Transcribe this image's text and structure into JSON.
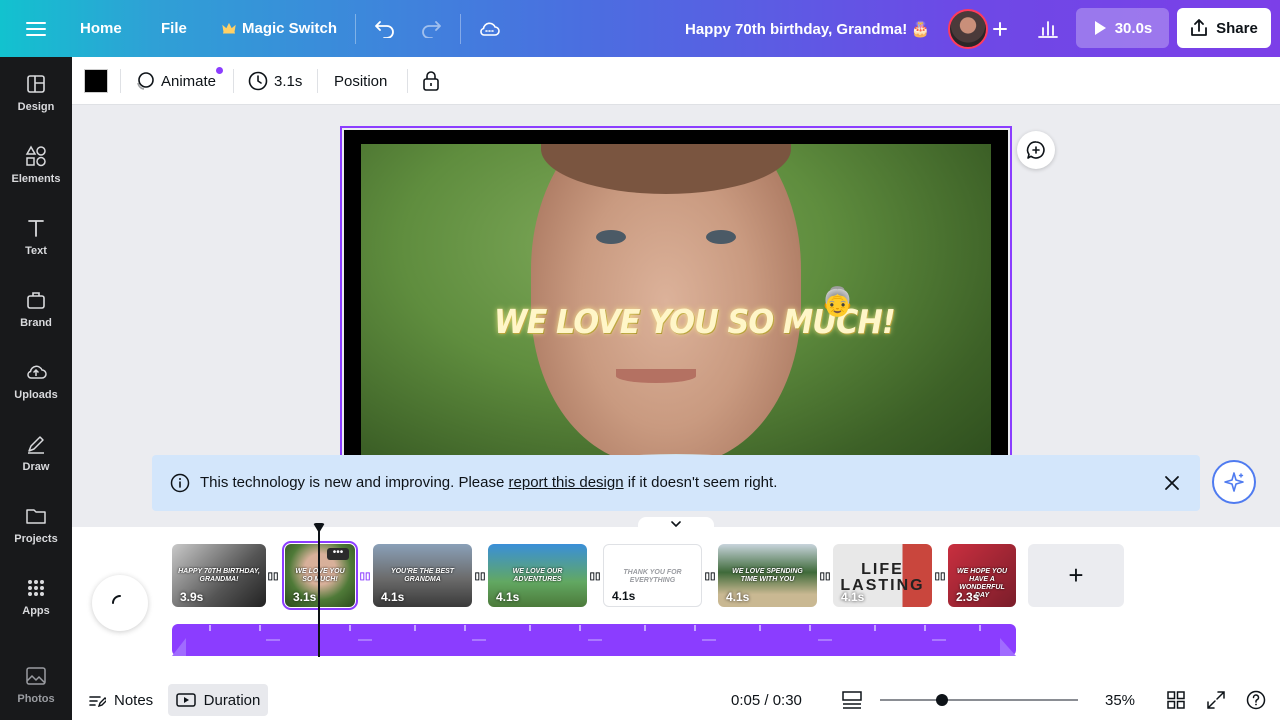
{
  "topbar": {
    "menu_icon": "hamburger-icon",
    "home": "Home",
    "file": "File",
    "magic_switch": "Magic Switch",
    "title": "Happy 70th birthday, Grandma! 🎂",
    "play_duration": "30.0s",
    "share": "Share"
  },
  "sidebar": {
    "items": [
      {
        "label": "Design",
        "icon": "layout-icon"
      },
      {
        "label": "Elements",
        "icon": "shapes-icon"
      },
      {
        "label": "Text",
        "icon": "text-icon"
      },
      {
        "label": "Brand",
        "icon": "brand-icon"
      },
      {
        "label": "Uploads",
        "icon": "cloud-upload-icon"
      },
      {
        "label": "Draw",
        "icon": "pen-icon"
      },
      {
        "label": "Projects",
        "icon": "folder-icon"
      },
      {
        "label": "Apps",
        "icon": "grid-icon"
      },
      {
        "label": "Photos",
        "icon": "image-icon"
      }
    ]
  },
  "toolbar": {
    "color": "#000000",
    "animate": "Animate",
    "timing": "3.1s",
    "position": "Position"
  },
  "canvas": {
    "headline": "WE LOVE YOU SO MUCH!",
    "emoji": "👵"
  },
  "banner": {
    "text_before": "This technology is new and improving. Please",
    "link": "report this design",
    "text_after": "if it doesn't seem right."
  },
  "timeline": {
    "clips": [
      {
        "duration": "3.9s",
        "text": "HAPPY 70TH BIRTHDAY, GRANDMA!"
      },
      {
        "duration": "3.1s",
        "text": "WE LOVE YOU SO MUCH!"
      },
      {
        "duration": "4.1s",
        "text": "YOU'RE THE BEST GRANDMA"
      },
      {
        "duration": "4.1s",
        "text": "WE LOVE OUR ADVENTURES"
      },
      {
        "duration": "4.1s",
        "text": "THANK YOU FOR EVERYTHING"
      },
      {
        "duration": "4.1s",
        "text": "WE LOVE SPENDING TIME WITH YOU"
      },
      {
        "duration": "4.1s",
        "text": "LIFE LASTING"
      },
      {
        "duration": "2.3s",
        "text": "WE HOPE YOU HAVE A WONDERFUL DAY"
      }
    ],
    "add_clip": "+"
  },
  "bottombar": {
    "notes": "Notes",
    "duration": "Duration",
    "time": "0:05 / 0:30",
    "zoom": "35%"
  },
  "colors": {
    "accent": "#8b3dff",
    "sidebar_bg": "#18191b",
    "banner_bg": "#d3e6fb"
  }
}
